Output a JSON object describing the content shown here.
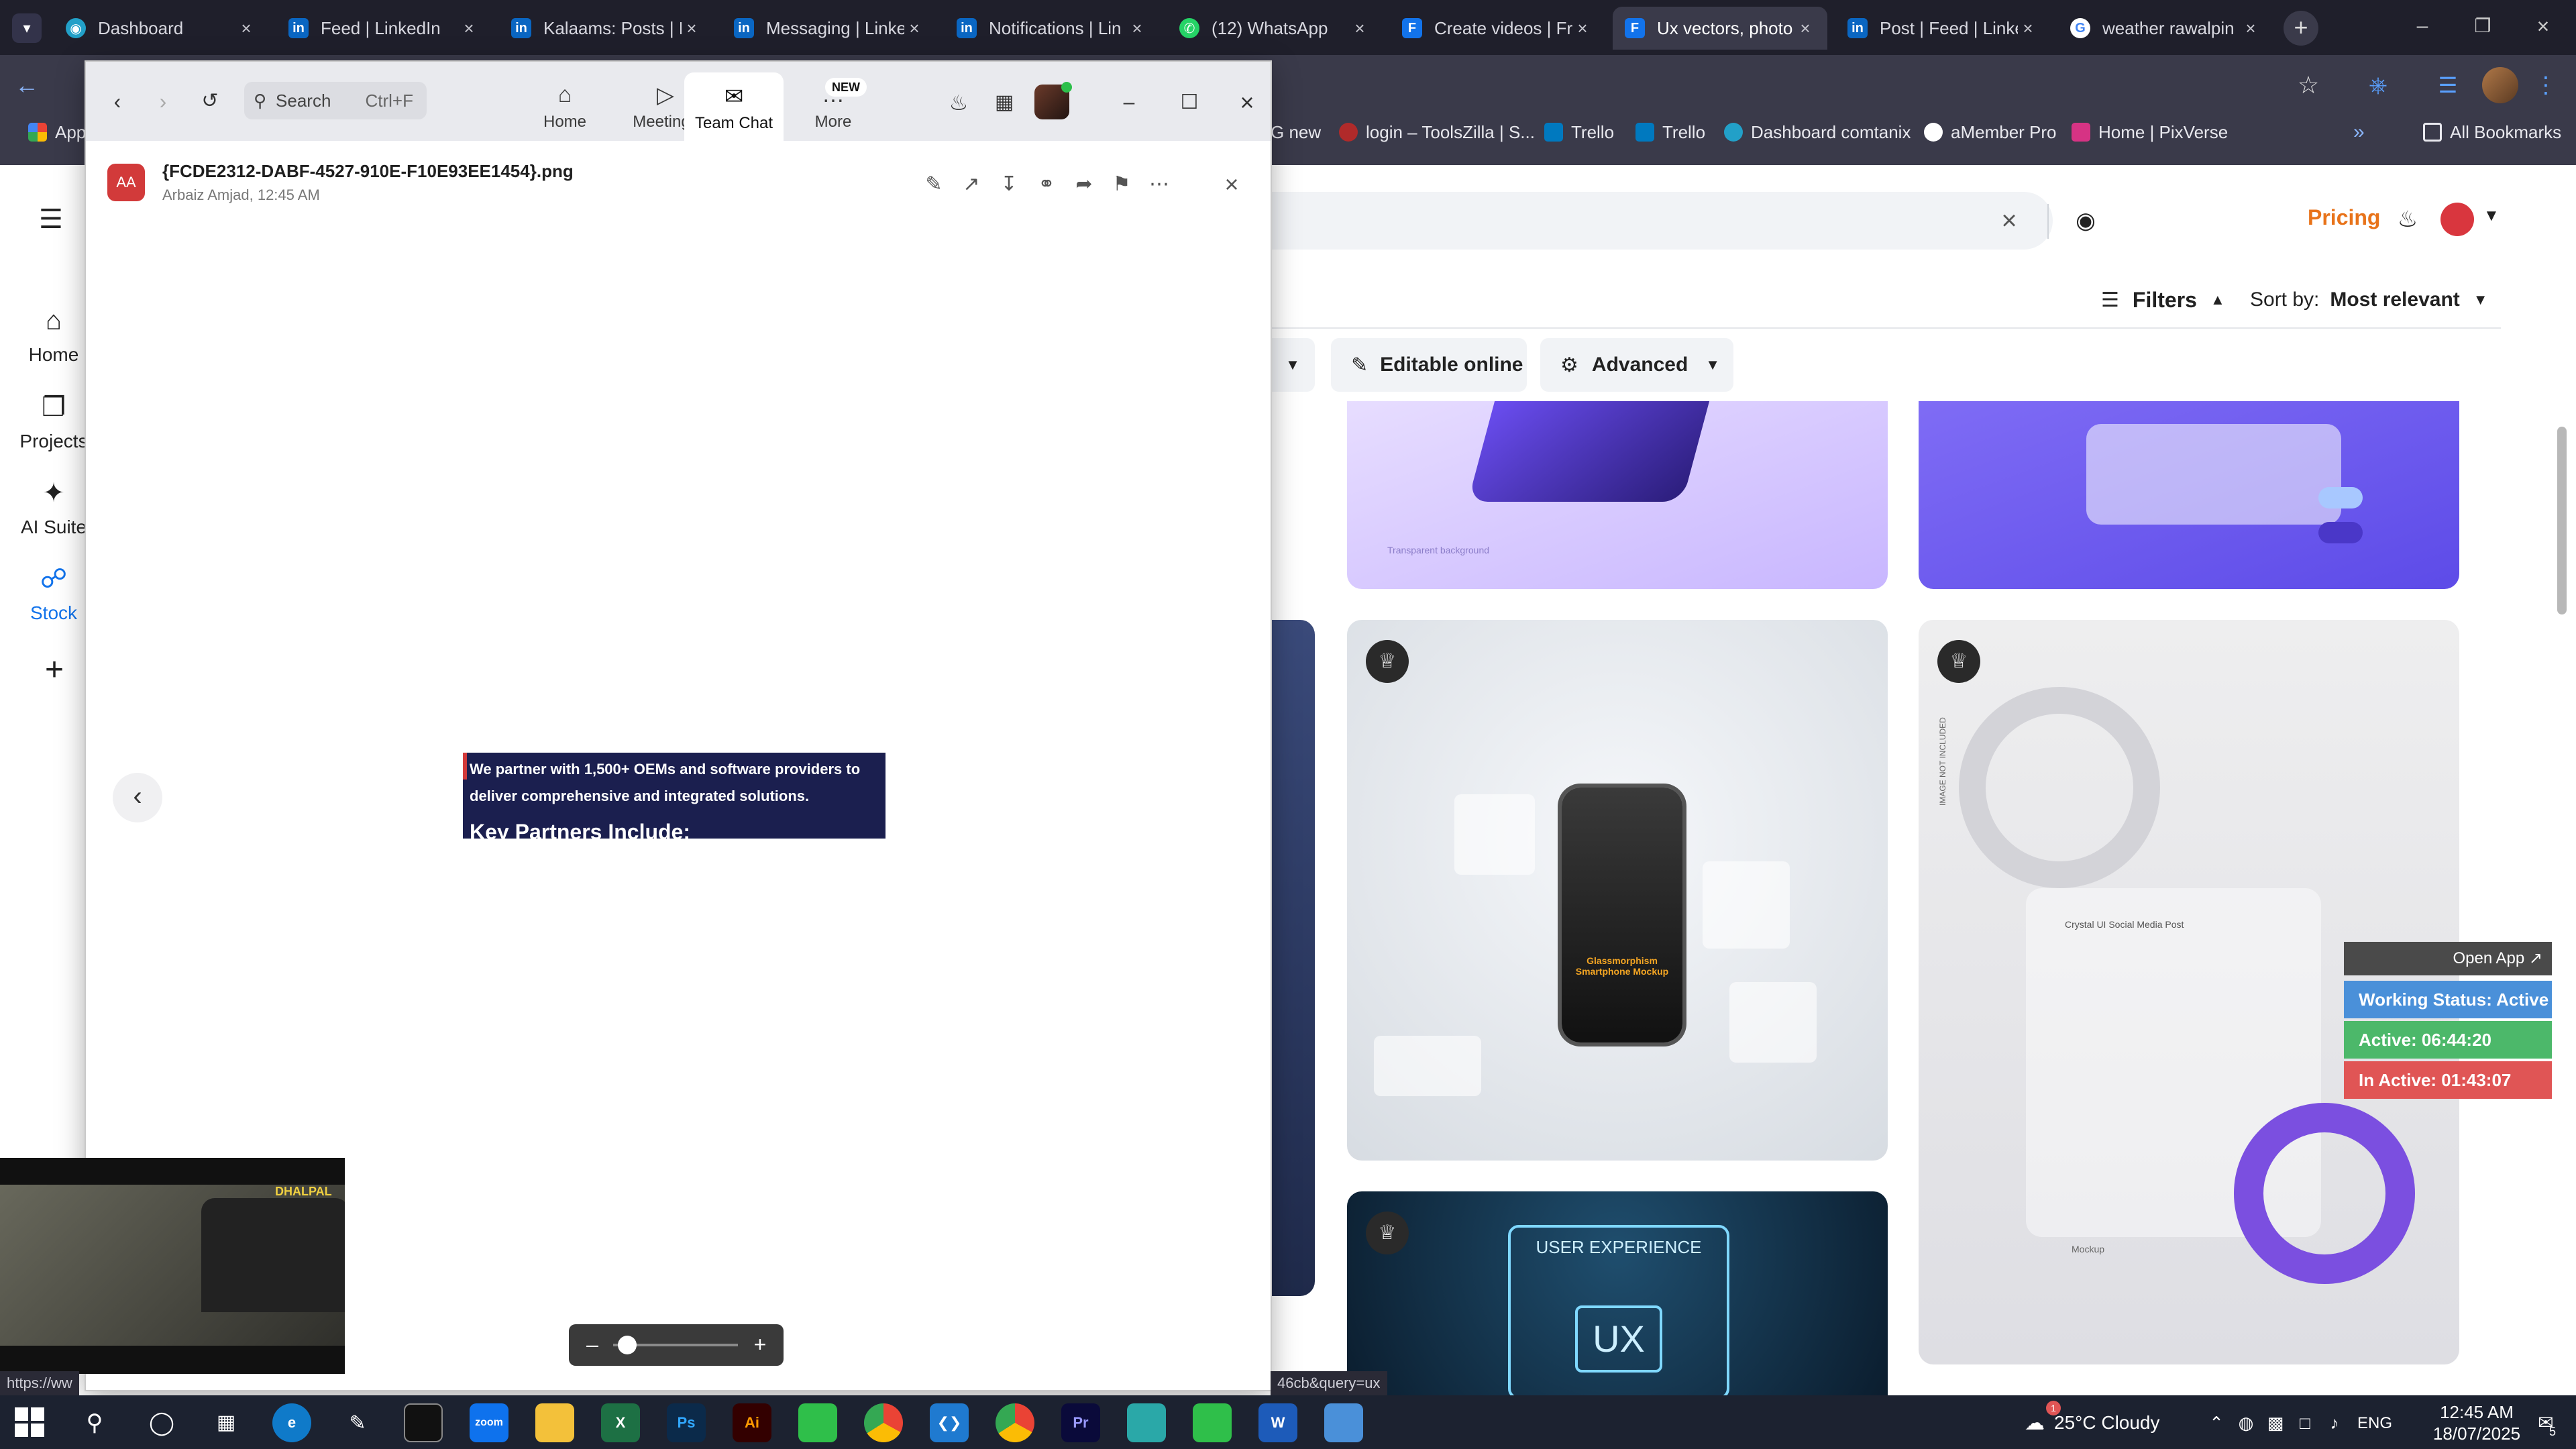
{
  "browser": {
    "tabs": [
      {
        "title": "Dashboard",
        "icon": "dashboard-favicon",
        "color": "#22a0c8"
      },
      {
        "title": "Feed | LinkedIn",
        "icon": "linkedin-favicon",
        "color": "#0a66c2"
      },
      {
        "title": "Kalaams: Posts | Li",
        "icon": "linkedin-favicon",
        "color": "#0a66c2"
      },
      {
        "title": "Messaging | Linke",
        "icon": "linkedin-favicon",
        "color": "#0a66c2"
      },
      {
        "title": "Notifications | Lin",
        "icon": "linkedin-favicon",
        "color": "#0a66c2"
      },
      {
        "title": "(12) WhatsApp",
        "icon": "whatsapp-favicon",
        "color": "#25d366"
      },
      {
        "title": "Create videos | Fr",
        "icon": "freepik-favicon",
        "color": "#1273eb"
      },
      {
        "title": "Ux vectors, photo",
        "icon": "freepik-favicon",
        "color": "#1273eb",
        "active": true
      },
      {
        "title": "Post | Feed | Linke",
        "icon": "linkedin-favicon",
        "color": "#0a66c2"
      },
      {
        "title": "weather rawalpin",
        "icon": "google-favicon",
        "color": "#ffffff"
      }
    ],
    "bookmarks": [
      {
        "label": "Apps"
      },
      {
        "label": "G new"
      },
      {
        "label": "login – ToolsZilla | S..."
      },
      {
        "label": "Trello"
      },
      {
        "label": "Trello"
      },
      {
        "label": "Dashboard comtanix"
      },
      {
        "label": "aMember Pro"
      },
      {
        "label": "Home | PixVerse"
      }
    ],
    "all_bookmarks": "All Bookmarks",
    "status_url_left": "https://ww",
    "status_url_right": "46cb&query=ux"
  },
  "site": {
    "nav": [
      {
        "label": "Home",
        "icon": "home-icon"
      },
      {
        "label": "Projects",
        "icon": "projects-icon"
      },
      {
        "label": "AI Suite",
        "icon": "ai-suite-icon"
      },
      {
        "label": "Stock",
        "icon": "stock-icon"
      }
    ],
    "pricing": "Pricing",
    "filters": "Filters",
    "sort_label": "Sort by:",
    "sort_value": "Most relevant",
    "editable_online": "Editable online",
    "advanced": "Advanced",
    "card_ux_title": "USER EXPERIENCE",
    "card_ux_badge": "UX",
    "card_phone_title": "Glassmorphism Smartphone Mockup",
    "card_social_title": "Crystal UI Social Media Post",
    "card_social_tag": "Mockup",
    "image_not_included": "IMAGE NOT INCLUDED",
    "transparent_bg": "Transparent background"
  },
  "zoom": {
    "search_placeholder": "Search",
    "search_shortcut": "Ctrl+F",
    "tabs": [
      {
        "label": "Home",
        "icon": "home-icon"
      },
      {
        "label": "Meetings",
        "icon": "video-camera-icon"
      },
      {
        "label": "Team Chat",
        "icon": "chat-bubbles-icon",
        "active": true
      },
      {
        "label": "More",
        "icon": "more-dots-icon",
        "badge": "NEW"
      }
    ],
    "avatar_initials": "AA",
    "file_name": "{FCDE2312-DABF-4527-910E-F10E93EE1454}.png",
    "sender": "Arbaiz Amjad, 12:45 AM",
    "preview_line1": "We partner with 1,500+ OEMs and software providers to",
    "preview_line2": "deliver comprehensive and integrated solutions.",
    "preview_line3": "Key Partners Include:",
    "zoom_level": 0.1
  },
  "status_widget": {
    "open_app": "Open App ↗",
    "working": "Working Status: Active",
    "active": "Active: 06:44:20",
    "inactive": "In Active: 01:43:07"
  },
  "video_overlay": {
    "caption": "DHALPAL"
  },
  "taskbar": {
    "weather": "25°C  Cloudy",
    "lang": "ENG",
    "time": "12:45 AM",
    "date": "18/07/2025",
    "notif_count": "5",
    "weather_badge": "1"
  },
  "colors": {
    "accent_zoom": "#0e72ed",
    "pricing_orange": "#e8731a",
    "status_blue": "#4a90d9",
    "status_green": "#4cb86a",
    "status_red": "#e05555"
  }
}
